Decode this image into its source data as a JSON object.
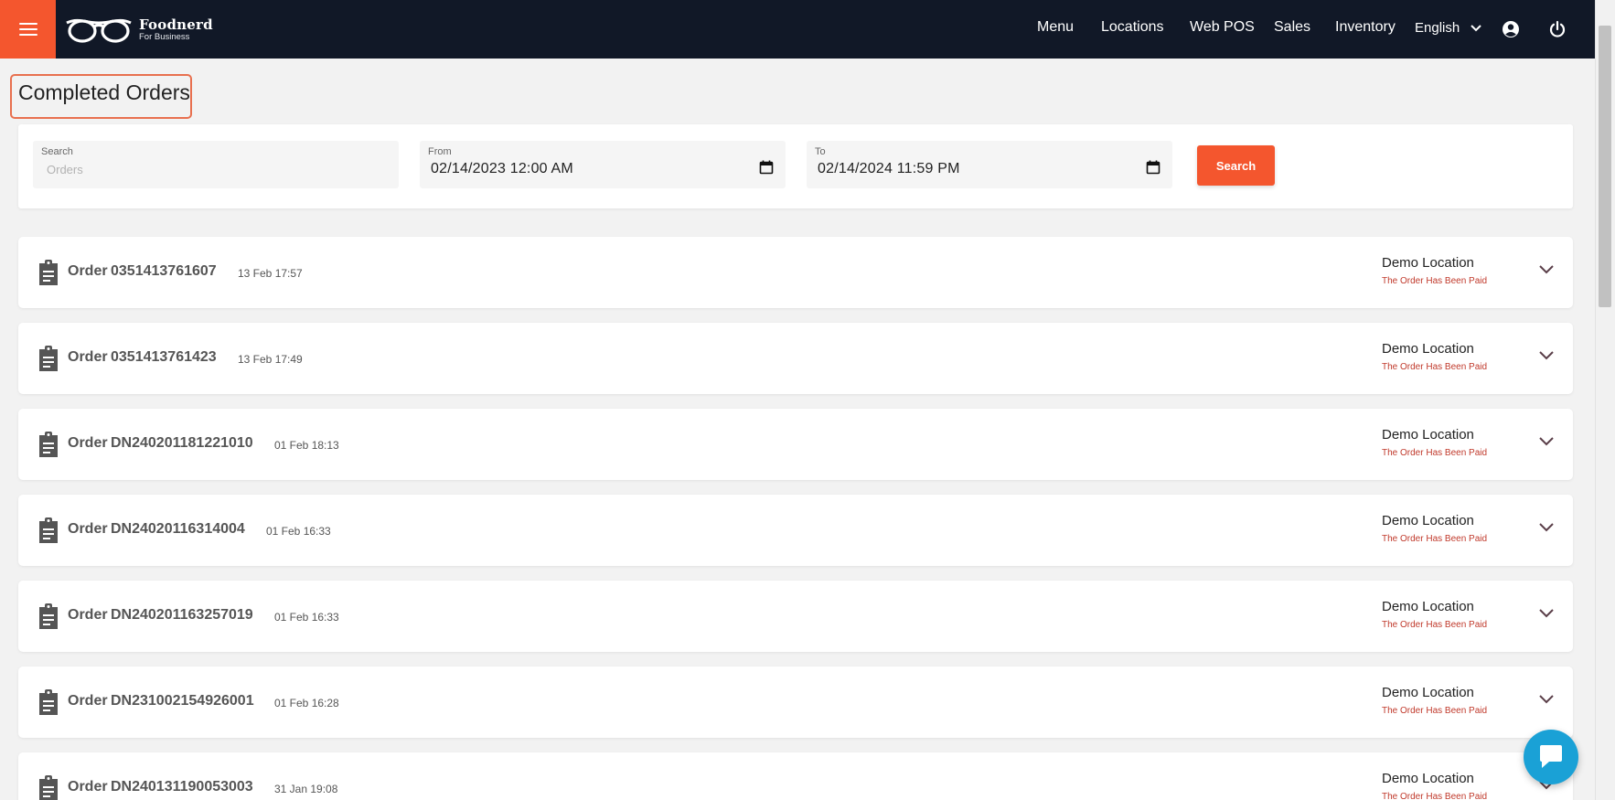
{
  "brand": {
    "name": "Foodnerd",
    "tagline": "For Business"
  },
  "nav": {
    "links": [
      "Menu",
      "Locations",
      "Web POS",
      "Sales",
      "Inventory"
    ],
    "language": "English",
    "icons": [
      "menu-icon",
      "account-icon",
      "power-icon",
      "chevron-down-icon"
    ]
  },
  "page": {
    "title": "Completed Orders"
  },
  "filters": {
    "search_label": "Search",
    "search_placeholder": "Orders",
    "from_label": "From",
    "from_value": "02/14/2023 12:00 AM",
    "to_label": "To",
    "to_value": "02/14/2024 11:59 PM",
    "search_button": "Search"
  },
  "orders": [
    {
      "label": "Order",
      "id": "0351413761607",
      "date": "13 Feb 17:57",
      "location": "Demo Location",
      "status": "The Order Has Been Paid"
    },
    {
      "label": "Order",
      "id": "0351413761423",
      "date": "13 Feb 17:49",
      "location": "Demo Location",
      "status": "The Order Has Been Paid"
    },
    {
      "label": "Order",
      "id": "DN240201181221010",
      "date": "01 Feb 18:13",
      "location": "Demo Location",
      "status": "The Order Has Been Paid"
    },
    {
      "label": "Order",
      "id": "DN24020116314004",
      "date": "01 Feb 16:33",
      "location": "Demo Location",
      "status": "The Order Has Been Paid"
    },
    {
      "label": "Order",
      "id": "DN240201163257019",
      "date": "01 Feb 16:33",
      "location": "Demo Location",
      "status": "The Order Has Been Paid"
    },
    {
      "label": "Order",
      "id": "DN231002154926001",
      "date": "01 Feb 16:28",
      "location": "Demo Location",
      "status": "The Order Has Been Paid"
    },
    {
      "label": "Order",
      "id": "DN240131190053003",
      "date": "31 Jan 19:08",
      "location": "Demo Location",
      "status": "The Order Has Been Paid"
    }
  ],
  "colors": {
    "navbar": "#111827",
    "accent": "#f4562e",
    "status": "#c0392b",
    "chat": "#1aa1d6"
  }
}
